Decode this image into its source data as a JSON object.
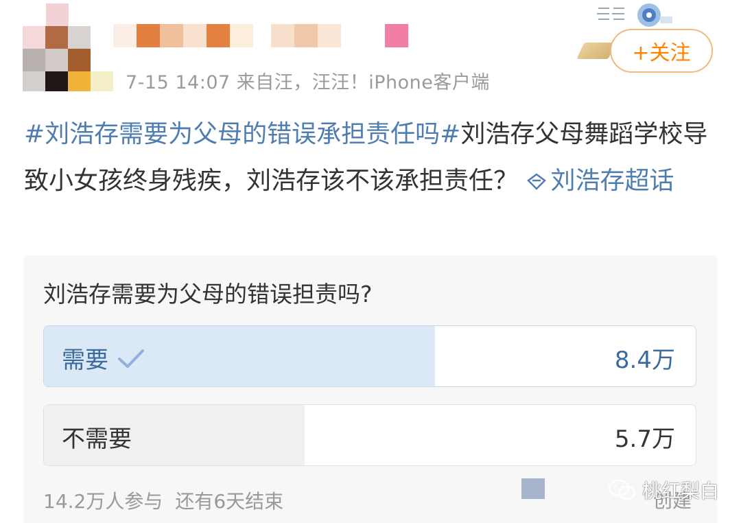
{
  "header": {
    "meta": "7-15 14:07  来自汪，汪汪！iPhone客户端",
    "follow_label": "+关注"
  },
  "post": {
    "hashtag": "#刘浩存需要为父母的错误承担责任吗#",
    "body": "刘浩存父母舞蹈学校导致小女孩终身残疾，刘浩存该不该承担责任？",
    "super_topic": "刘浩存超话"
  },
  "poll": {
    "question": "刘浩存需要为父母的错误担责吗?",
    "options": [
      {
        "label": "需要",
        "count": "8.4万",
        "selected": true,
        "share": 0.6
      },
      {
        "label": "不需要",
        "count": "5.7万",
        "selected": false,
        "share": 0.4
      }
    ],
    "participants": "14.2万人参与",
    "remaining": "还有6天结束",
    "create_label": "创建"
  },
  "watermark": "桃红梨白",
  "colors": {
    "link": "#507daf",
    "follow": "#ff8200",
    "selected_fill": "#dbe8f6"
  },
  "icons": [
    "follow-plus-icon",
    "super-topic-diamond-icon",
    "check-icon",
    "wechat-icon"
  ]
}
